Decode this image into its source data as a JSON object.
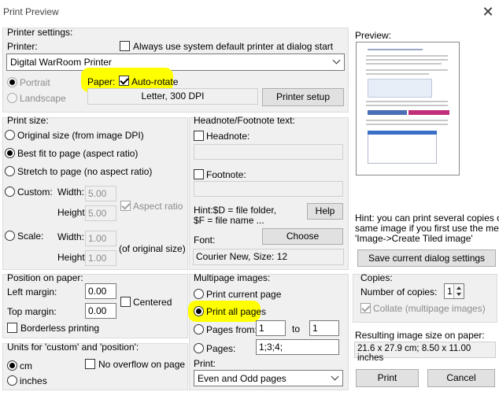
{
  "window": {
    "title": "Print Preview"
  },
  "printer_settings": {
    "group_label": "Printer settings:",
    "printer_label": "Printer:",
    "always_default_label": "Always use system default printer at dialog start",
    "printer_value": "Digital WarRoom Printer",
    "portrait_label": "Portrait",
    "landscape_label": "Landscape",
    "paper_label": "Paper:",
    "auto_rotate_label": "Auto-rotate",
    "paper_info": "Letter,   300 DPI",
    "printer_setup_button": "Printer setup"
  },
  "preview": {
    "label": "Preview:"
  },
  "print_size": {
    "group_label": "Print size:",
    "original_label": "Original size (from image DPI)",
    "best_fit_label": "Best fit to page (aspect ratio)",
    "stretch_label": "Stretch to page (no aspect ratio)",
    "custom_label": "Custom:",
    "width_label": "Width:",
    "height_label": "Height:",
    "custom_width": "5.00",
    "custom_height": "5.00",
    "aspect_ratio_label": "Aspect ratio",
    "scale_label": "Scale:",
    "scale_width": "1.00",
    "scale_height": "1.00",
    "of_original_label": "(of original size)"
  },
  "headnote": {
    "group_label": "Headnote/Footnote text:",
    "headnote_label": "Headnote:",
    "footnote_label": "Footnote:",
    "hint_line1": "Hint:$D = file folder,",
    "hint_line2": "$F = file name ...",
    "help_button": "Help",
    "font_label": "Font:",
    "choose_button": "Choose",
    "font_value": "Courier New, Size: 12"
  },
  "tip": {
    "line1": "Hint: you can print several copies of",
    "line2": "same image if you first use the menu:",
    "line3": "'Image->Create Tiled image'"
  },
  "save_settings_button": "Save current dialog settings",
  "position": {
    "group_label": "Position on paper:",
    "left_margin_label": "Left margin:",
    "left_margin_value": "0.00",
    "top_margin_label": "Top margin:",
    "top_margin_value": "0.00",
    "centered_label": "Centered",
    "borderless_label": "Borderless printing"
  },
  "units": {
    "group_label": "Units for 'custom' and 'position':",
    "cm_label": "cm",
    "inches_label": "inches",
    "no_overflow_label": "No overflow on page"
  },
  "multipage": {
    "group_label": "Multipage images:",
    "print_current_label": "Print current page",
    "print_all_label": "Print all pages",
    "pages_from_label": "Pages from:",
    "pages_from_value": "1",
    "to_label": "to",
    "pages_to_value": "1",
    "pages_label": "Pages:",
    "pages_value": "1;3;4;",
    "print_label": "Print:",
    "print_value": "Even and Odd pages"
  },
  "copies": {
    "group_label": "Copies:",
    "number_label": "Number of copies:",
    "number_value": "1",
    "collate_label": "Collate (multipage images)"
  },
  "result": {
    "label": "Resulting image size on paper:",
    "value": "21.6 x 27.9 cm; 8.50 x 11.00 inches"
  },
  "buttons": {
    "print": "Print",
    "cancel": "Cancel"
  },
  "colors": {
    "highlight": "#ffff00",
    "panel": "#f0f0f0",
    "button": "#e1e1e1"
  }
}
